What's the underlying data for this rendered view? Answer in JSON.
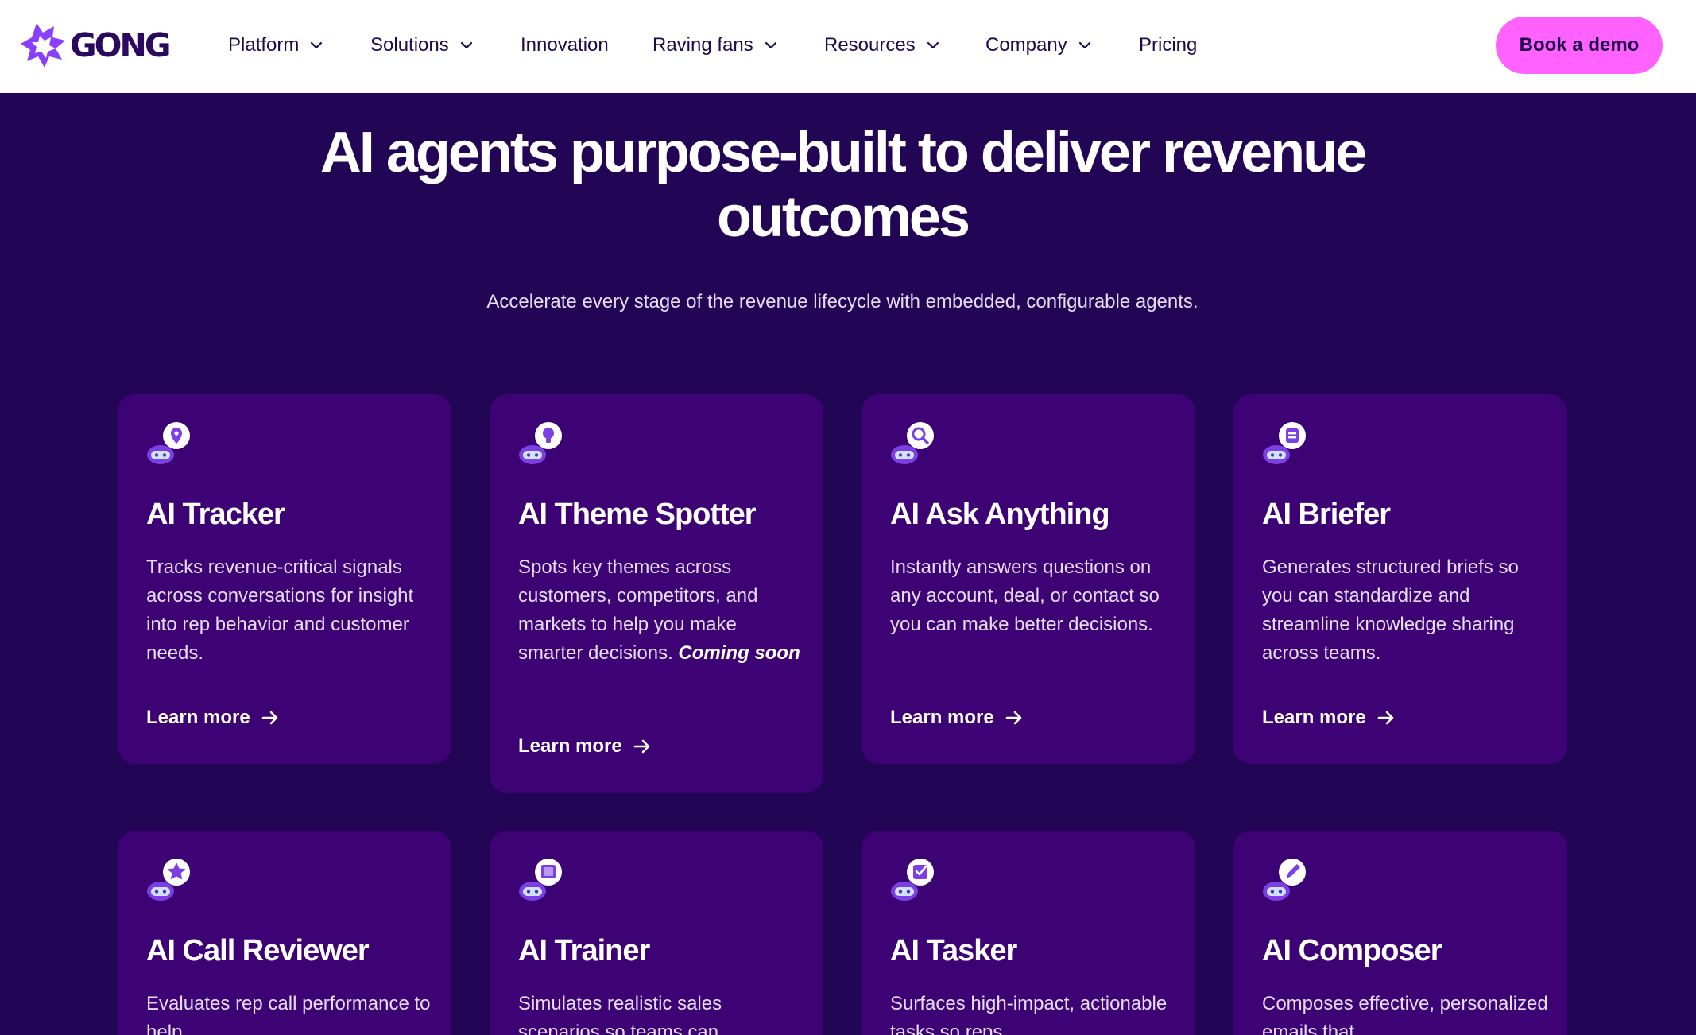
{
  "brand": {
    "name": "GONG"
  },
  "nav": {
    "items": [
      {
        "label": "Platform"
      },
      {
        "label": "Solutions"
      },
      {
        "label": "Innovation"
      },
      {
        "label": "Raving fans"
      },
      {
        "label": "Resources"
      },
      {
        "label": "Company"
      },
      {
        "label": "Pricing"
      }
    ],
    "cta": "Book a demo"
  },
  "hero": {
    "title_line1": "AI agents purpose-built to deliver revenue",
    "title_line2": "outcomes",
    "subtitle": "Accelerate every stage of the revenue lifecycle with embedded, configurable agents."
  },
  "cards": [
    {
      "title": "AI Tracker",
      "description": "Tracks revenue-critical signals across conversations for insight into rep behavior and customer needs.",
      "link": "Learn more",
      "icon": "robot-location-pin-icon"
    },
    {
      "title": "AI Theme Spotter",
      "description": "Spots key themes across customers, competitors, and markets to help you make smarter decisions.",
      "emphasis": "Coming soon",
      "link": "Learn more",
      "icon": "robot-lightbulb-icon"
    },
    {
      "title": "AI Ask Anything",
      "description": "Instantly answers questions on any account, deal, or contact so you can make better decisions.",
      "link": "Learn more",
      "icon": "robot-magnifier-icon"
    },
    {
      "title": "AI Briefer",
      "description": "Generates structured briefs so you can standardize and streamline knowledge sharing across teams.",
      "link": "Learn more",
      "icon": "robot-document-icon"
    },
    {
      "title": "AI Call Reviewer",
      "description": "Evaluates rep call performance to help",
      "icon": "robot-star-icon"
    },
    {
      "title": "AI Trainer",
      "description": "Simulates realistic sales scenarios so teams can",
      "icon": "robot-frame-icon"
    },
    {
      "title": "AI Tasker",
      "description": "Surfaces high-impact, actionable tasks so reps",
      "icon": "robot-checklist-icon"
    },
    {
      "title": "AI Composer",
      "description": "Composes effective, personalized emails that",
      "icon": "robot-pen-icon"
    }
  ],
  "colors": {
    "background": "#220554",
    "card": "#3d0274",
    "cta": "#ff62ff",
    "nav_text": "#1f0a4a",
    "icon_accent": "#7b3fe4"
  }
}
